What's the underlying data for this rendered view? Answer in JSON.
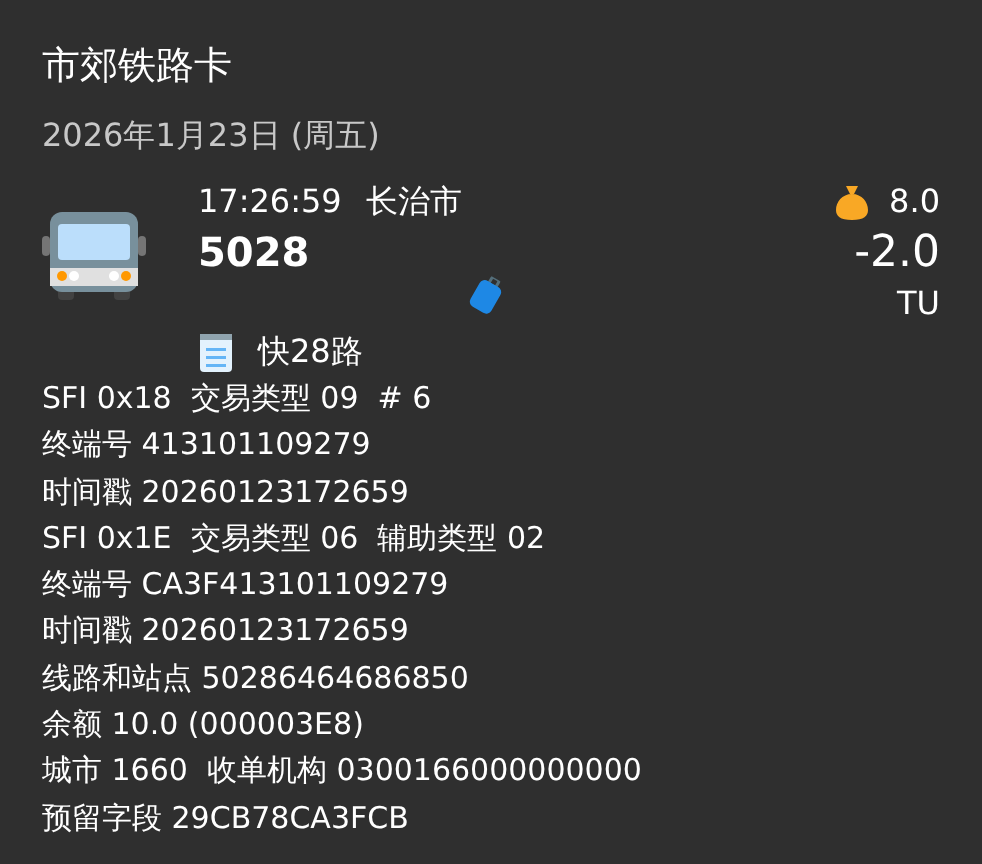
{
  "title": "市郊铁路卡",
  "date": "2026年1月23日 (周五)",
  "transaction": {
    "time": "17:26:59",
    "city": "长治市",
    "number": "5028",
    "balance": "8.0",
    "amount": "-2.0",
    "currency": "TU",
    "route": "快28路"
  },
  "details": [
    "SFI 0x18  交易类型 09  # 6",
    "终端号 413101109279",
    "时间戳 20260123172659",
    "SFI 0x1E  交易类型 06  辅助类型 02",
    "终端号 CA3F413101109279",
    "时间戳 20260123172659",
    "线路和站点 50286464686850",
    "余额 10.0 (000003E8)",
    "城市 1660  收单机构 0300166000000000",
    "预留字段 29CB78CA3FCB"
  ]
}
